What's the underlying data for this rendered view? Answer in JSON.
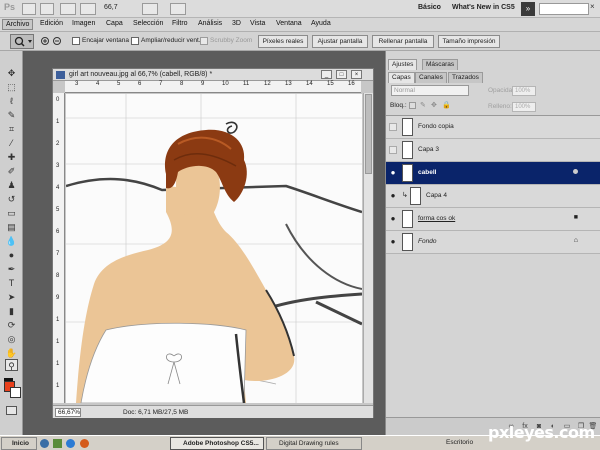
{
  "app": {
    "logo": "Ps",
    "zoom": "66,7",
    "workspace_basic": "Básico",
    "workspace_new": "What's New in CS5"
  },
  "menus": [
    "Archivo",
    "Edición",
    "Imagen",
    "Capa",
    "Selección",
    "Filtro",
    "Análisis",
    "3D",
    "Vista",
    "Ventana",
    "Ayuda"
  ],
  "options": {
    "encajar": "Encajar ventana",
    "ampliar": "Ampliar/reducir vent.",
    "scrubby": "Scrubby Zoom",
    "btn_pixeles": "Píxeles reales",
    "btn_ajustar": "Ajustar pantalla",
    "btn_rellenar": "Rellenar pantalla",
    "btn_tamano": "Tamaño impresión"
  },
  "document": {
    "title": "girl art nouveau.jpg al 66,7% (cabell, RGB/8) *",
    "zoom": "66,67%",
    "info": "Doc: 6,71 MB/27,5 MB",
    "ruler_top": [
      "3",
      "4",
      "5",
      "6",
      "7",
      "8",
      "9",
      "10",
      "11",
      "12",
      "13",
      "14",
      "15",
      "16"
    ],
    "ruler_left": [
      "0",
      "1",
      "2",
      "3",
      "4",
      "5",
      "6",
      "7",
      "8",
      "9",
      "1",
      "1",
      "1",
      "1"
    ]
  },
  "panel": {
    "top_tabs": [
      "Ajustes",
      "Máscaras"
    ],
    "tabs": [
      "Capas",
      "Canales",
      "Trazados"
    ],
    "blend_mode": "Normal",
    "opacity_label": "Opacidad:",
    "opacity_value": "100%",
    "fill_label": "Relleno:",
    "fill_value": "100%",
    "lock_label": "Bloq.:",
    "layers": [
      {
        "name": "Fondo copia",
        "visible": false,
        "selected": false
      },
      {
        "name": "Capa 3",
        "visible": false,
        "selected": false
      },
      {
        "name": "cabell",
        "visible": true,
        "selected": true
      },
      {
        "name": "Capa 4",
        "visible": true,
        "selected": false
      },
      {
        "name": "forma cos ok",
        "visible": true,
        "selected": false
      },
      {
        "name": "Fondo",
        "visible": true,
        "selected": false
      }
    ]
  },
  "taskbar": {
    "start": "Inicio",
    "tasks": [
      "Adobe Photoshop CS5...",
      "Digital Drawing rules"
    ],
    "tray": "Escritorio"
  },
  "watermark": "pxleyes.com",
  "colors": {
    "foreground": "#e8401c",
    "background": "#ffffff",
    "hair": "#8b3a12",
    "skin": "#ebc596",
    "selection": "#0a246a"
  }
}
